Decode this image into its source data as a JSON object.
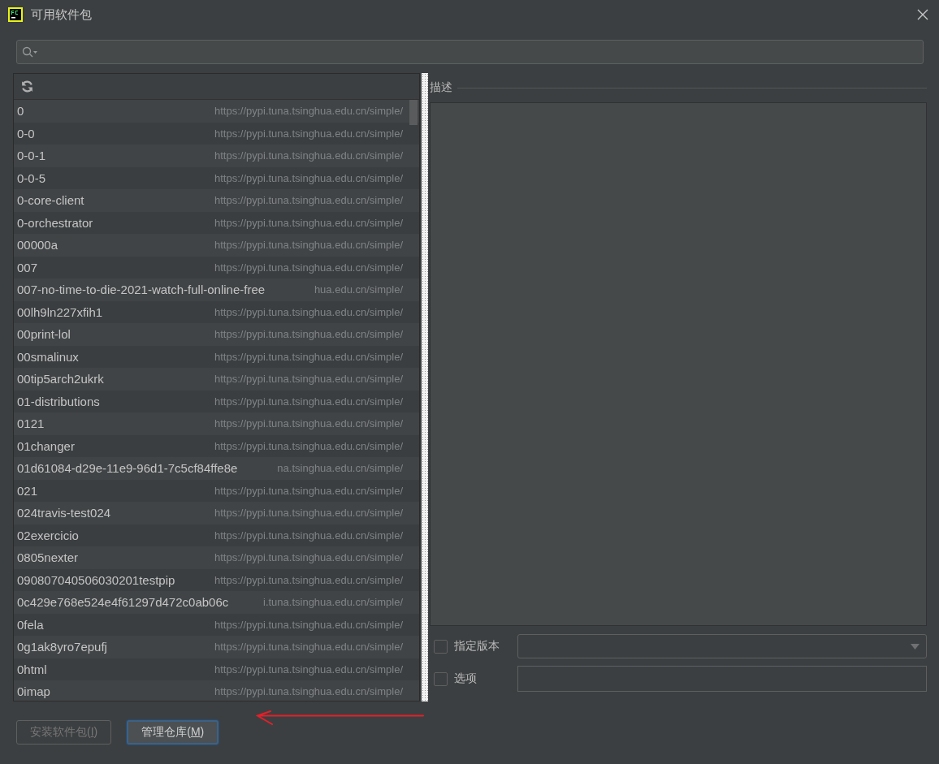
{
  "window": {
    "title": "可用软件包"
  },
  "packages": [
    {
      "name": "0",
      "url": "https://pypi.tuna.tsinghua.edu.cn/simple/"
    },
    {
      "name": "0-0",
      "url": "https://pypi.tuna.tsinghua.edu.cn/simple/"
    },
    {
      "name": "0-0-1",
      "url": "https://pypi.tuna.tsinghua.edu.cn/simple/"
    },
    {
      "name": "0-0-5",
      "url": "https://pypi.tuna.tsinghua.edu.cn/simple/"
    },
    {
      "name": "0-core-client",
      "url": "https://pypi.tuna.tsinghua.edu.cn/simple/"
    },
    {
      "name": "0-orchestrator",
      "url": "https://pypi.tuna.tsinghua.edu.cn/simple/"
    },
    {
      "name": "00000a",
      "url": "https://pypi.tuna.tsinghua.edu.cn/simple/"
    },
    {
      "name": "007",
      "url": "https://pypi.tuna.tsinghua.edu.cn/simple/"
    },
    {
      "name": "007-no-time-to-die-2021-watch-full-online-free",
      "url": "hua.edu.cn/simple/"
    },
    {
      "name": "00lh9ln227xfih1",
      "url": "https://pypi.tuna.tsinghua.edu.cn/simple/"
    },
    {
      "name": "00print-lol",
      "url": "https://pypi.tuna.tsinghua.edu.cn/simple/"
    },
    {
      "name": "00smalinux",
      "url": "https://pypi.tuna.tsinghua.edu.cn/simple/"
    },
    {
      "name": "00tip5arch2ukrk",
      "url": "https://pypi.tuna.tsinghua.edu.cn/simple/"
    },
    {
      "name": "01-distributions",
      "url": "https://pypi.tuna.tsinghua.edu.cn/simple/"
    },
    {
      "name": "0121",
      "url": "https://pypi.tuna.tsinghua.edu.cn/simple/"
    },
    {
      "name": "01changer",
      "url": "https://pypi.tuna.tsinghua.edu.cn/simple/"
    },
    {
      "name": "01d61084-d29e-11e9-96d1-7c5cf84ffe8e",
      "url": "na.tsinghua.edu.cn/simple/"
    },
    {
      "name": "021",
      "url": "https://pypi.tuna.tsinghua.edu.cn/simple/"
    },
    {
      "name": "024travis-test024",
      "url": "https://pypi.tuna.tsinghua.edu.cn/simple/"
    },
    {
      "name": "02exercicio",
      "url": "https://pypi.tuna.tsinghua.edu.cn/simple/"
    },
    {
      "name": "0805nexter",
      "url": "https://pypi.tuna.tsinghua.edu.cn/simple/"
    },
    {
      "name": "090807040506030201testpip",
      "url": "https://pypi.tuna.tsinghua.edu.cn/simple/"
    },
    {
      "name": "0c429e768e524e4f61297d472c0ab06c",
      "url": "i.tuna.tsinghua.edu.cn/simple/"
    },
    {
      "name": "0fela",
      "url": "https://pypi.tuna.tsinghua.edu.cn/simple/"
    },
    {
      "name": "0g1ak8yro7epufj",
      "url": "https://pypi.tuna.tsinghua.edu.cn/simple/"
    },
    {
      "name": "0html",
      "url": "https://pypi.tuna.tsinghua.edu.cn/simple/"
    },
    {
      "name": "0imap",
      "url": "https://pypi.tuna.tsinghua.edu.cn/simple/"
    }
  ],
  "description": {
    "label": "描述"
  },
  "options": [
    {
      "kind": "dropdown",
      "label": "指定版本",
      "checked": false
    },
    {
      "kind": "text",
      "label": "选项",
      "checked": false
    }
  ],
  "buttons": [
    {
      "label": "安装软件包(",
      "mnemonic": "I",
      "suffix": ")",
      "disabled": true,
      "focused": false
    },
    {
      "label": "管理仓库(",
      "mnemonic": "M",
      "suffix": ")",
      "disabled": false,
      "focused": true
    }
  ]
}
